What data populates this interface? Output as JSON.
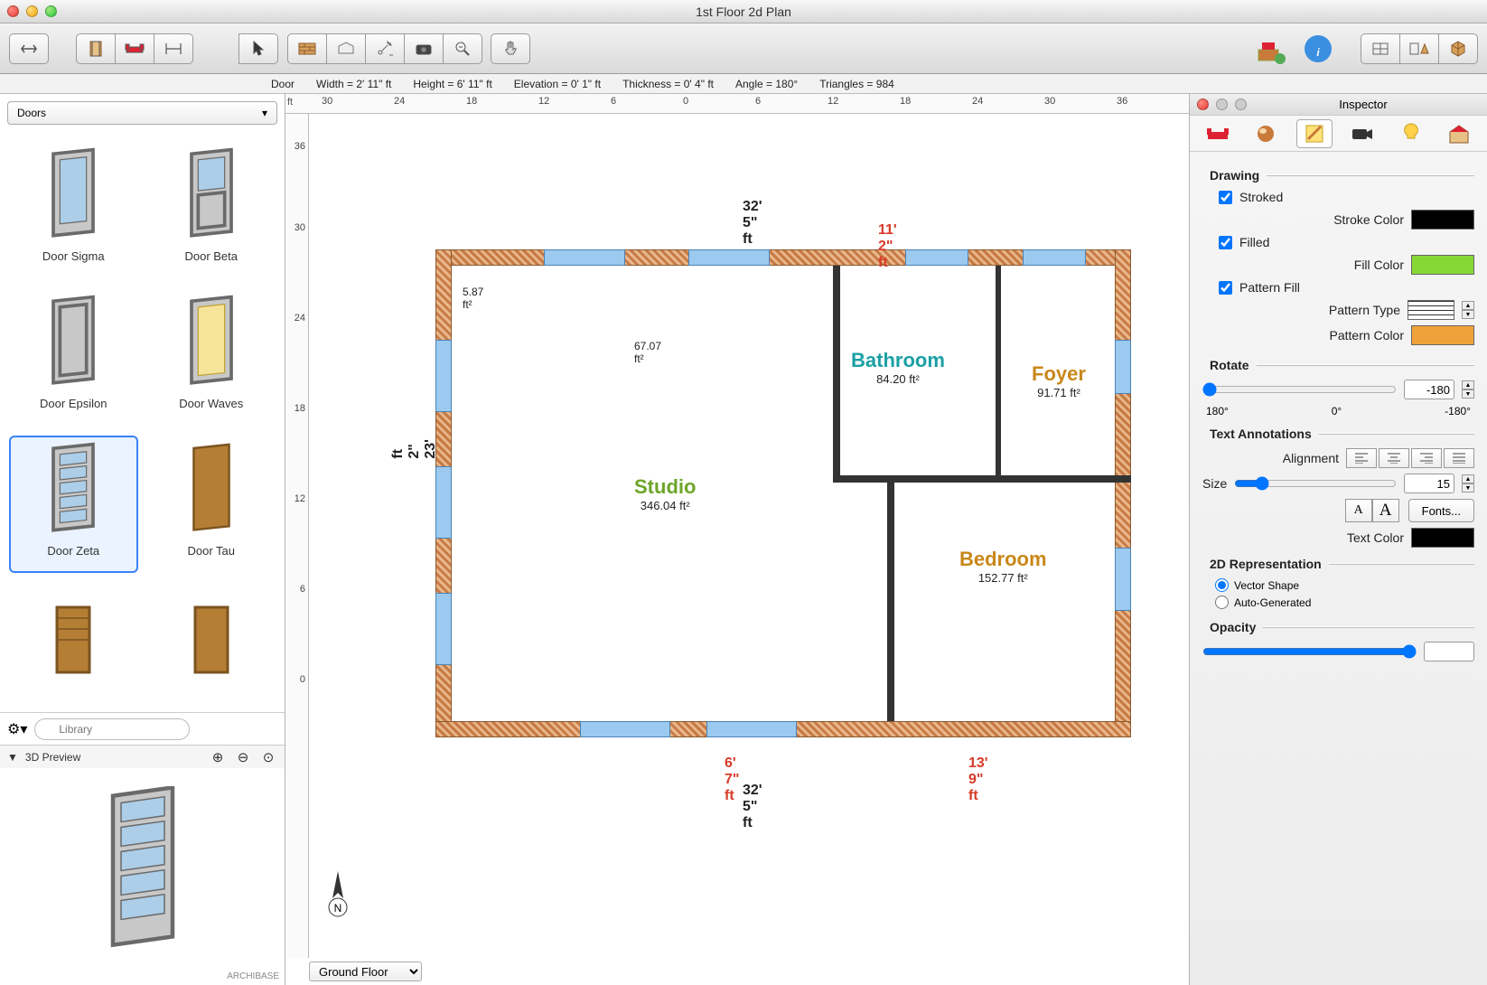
{
  "window": {
    "title": "1st Floor 2d Plan"
  },
  "status": {
    "object": "Door",
    "width": "Width = 2' 11\" ft",
    "height": "Height = 6' 11\" ft",
    "elevation": "Elevation = 0' 1\" ft",
    "thickness": "Thickness = 0' 4\" ft",
    "angle": "Angle = 180°",
    "triangles": "Triangles = 984"
  },
  "library": {
    "category": "Doors",
    "search_placeholder": "Library",
    "items": [
      {
        "name": "Door Sigma"
      },
      {
        "name": "Door Beta"
      },
      {
        "name": "Door Epsilon"
      },
      {
        "name": "Door Waves"
      },
      {
        "name": "Door Zeta",
        "selected": true
      },
      {
        "name": "Door Tau"
      }
    ],
    "preview_title": "3D Preview",
    "logo": "ARCHIBASE"
  },
  "ruler": {
    "unit": "ft",
    "h_ticks": [
      "30",
      "24",
      "18",
      "12",
      "6",
      "0",
      "6",
      "12",
      "18",
      "24",
      "30",
      "36"
    ],
    "v_ticks": [
      "36",
      "30",
      "24",
      "18",
      "12",
      "6",
      "0"
    ]
  },
  "floors": {
    "selected": "Ground Floor"
  },
  "plan": {
    "dims": {
      "outer_w": "32' 5\" ft",
      "outer_w_bottom": "32' 5\" ft",
      "outer_h": "23' 2\" ft",
      "bath_w": "11' 2\" ft",
      "bed_w": "13' 9\" ft",
      "left_bottom": "6' 7\" ft",
      "kitchen_area": "5.87 ft²",
      "hall_area": "67.07 ft²"
    },
    "rooms": {
      "studio": {
        "name": "Studio",
        "area": "346.04 ft²",
        "color": "#6ea52a"
      },
      "bathroom": {
        "name": "Bathroom",
        "area": "84.20 ft²",
        "color": "#1aa0a4"
      },
      "foyer": {
        "name": "Foyer",
        "area": "91.71 ft²",
        "color": "#c9871a"
      },
      "bedroom": {
        "name": "Bedroom",
        "area": "152.77 ft²",
        "color": "#c9871a"
      }
    }
  },
  "inspector": {
    "title": "Inspector",
    "drawing": {
      "title": "Drawing",
      "stroked": true,
      "stroked_label": "Stroked",
      "stroke_color_label": "Stroke Color",
      "stroke_color": "#000000",
      "filled": true,
      "filled_label": "Filled",
      "fill_color_label": "Fill Color",
      "fill_color": "#87d836",
      "pattern_fill": true,
      "pattern_fill_label": "Pattern Fill",
      "pattern_type_label": "Pattern Type",
      "pattern_color_label": "Pattern Color",
      "pattern_color": "#f0a23a",
      "rotate_label": "Rotate",
      "rotate_value": "-180",
      "rotate_min": "180°",
      "rotate_mid": "0°",
      "rotate_max": "-180°"
    },
    "text": {
      "title": "Text Annotations",
      "alignment_label": "Alignment",
      "size_label": "Size",
      "size_value": "15",
      "fonts_label": "Fonts...",
      "text_color_label": "Text Color",
      "text_color": "#000000"
    },
    "rep": {
      "title": "2D Representation",
      "vector_label": "Vector Shape",
      "auto_label": "Auto-Generated",
      "selected": "vector",
      "opacity_label": "Opacity"
    }
  }
}
